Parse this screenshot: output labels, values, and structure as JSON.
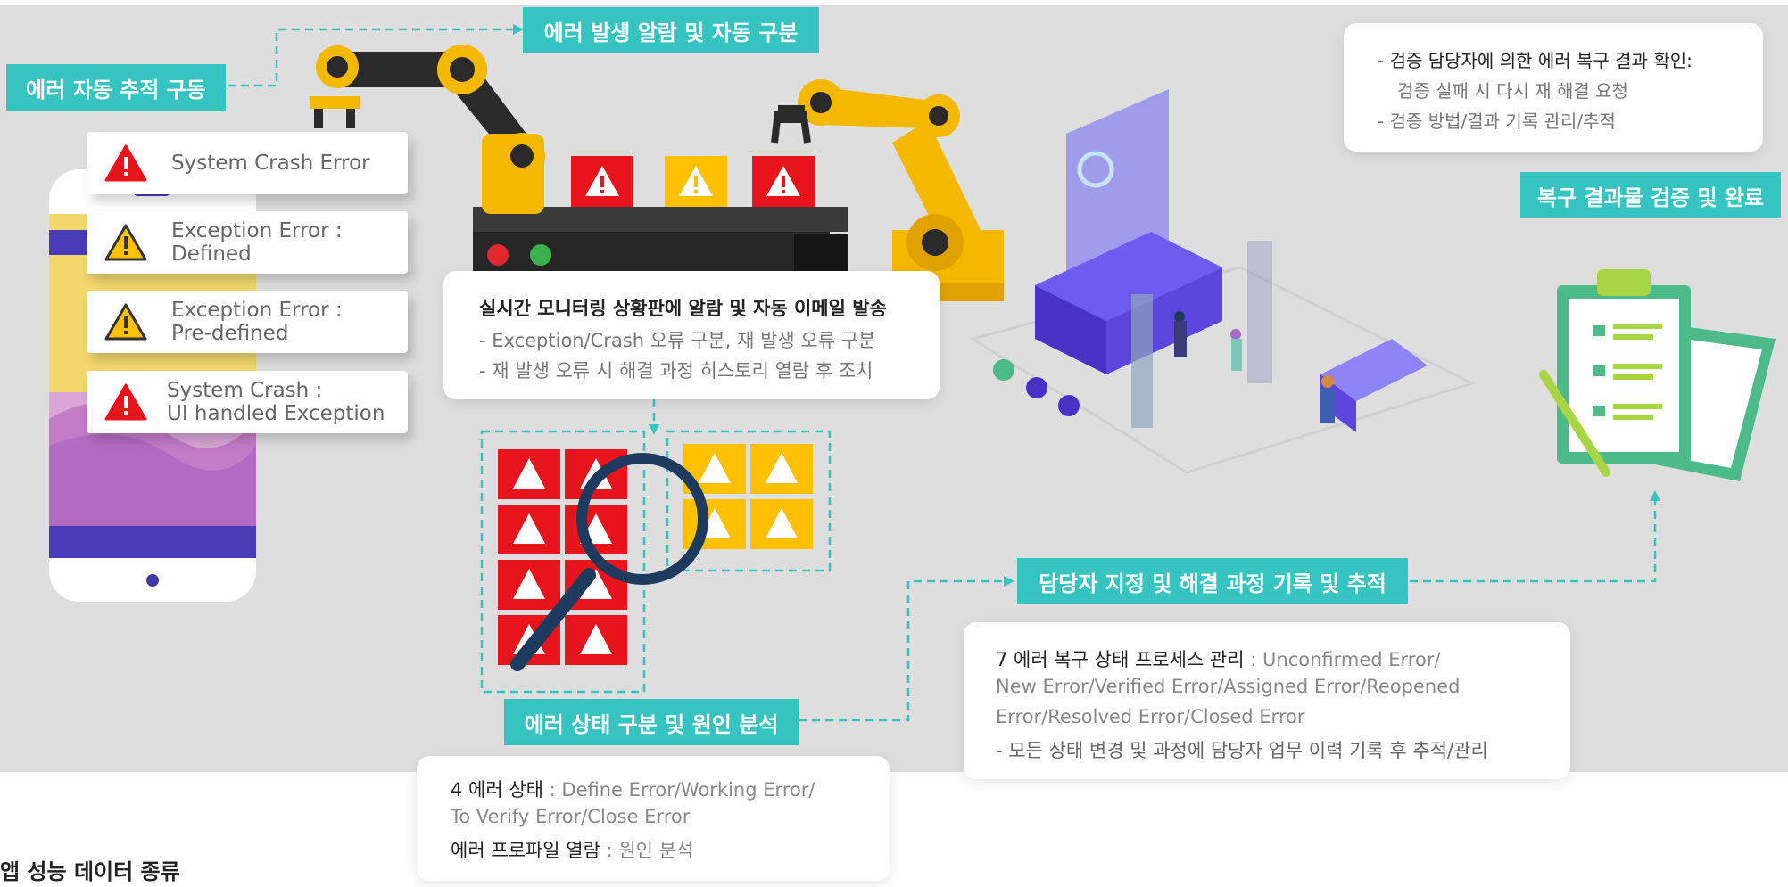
{
  "labels": {
    "auto_trace": "에러 자동 추적 구동",
    "alarm_classify": "에러 발생 알람 및 자동 구분",
    "status_analysis": "에러 상태 구분 및 원인 분석",
    "assign_track": "담당자 지정 및 해결 과정 기록 및 추적",
    "verify_complete": "복구 결과물 검증 및 완료"
  },
  "error_cards": [
    {
      "icon": "error-red-icon",
      "line1": "System Crash Error",
      "line2": ""
    },
    {
      "icon": "warning-yellow-icon",
      "line1": "Exception Error :",
      "line2": "Defined"
    },
    {
      "icon": "warning-yellow-icon",
      "line1": "Exception Error :",
      "line2": "Pre-defined"
    },
    {
      "icon": "error-red-icon",
      "line1": "System Crash :",
      "line2": "UI handled Exception"
    }
  ],
  "monitoring": {
    "title": "실시간 모니터링 상황판에 알람 및 자동 이메일 발송",
    "line1": "- Exception/Crash 오류 구분, 재 발생 오류 구분",
    "line2": "- 재 발생 오류 시 해결 과정 히스토리 열람 후 조치"
  },
  "verify_box": {
    "line1": "- 검증 담당자에 의한 에러 복구 결과 확인:",
    "line2": "검증 실패 시 다시 재 해결 요청",
    "line3": "- 검증 방법/결과 기록 관리/추적"
  },
  "process_box": {
    "bold": "7 에러 복구 상태 프로세스 관리",
    "sep": " : ",
    "line1_rest": "Unconfirmed Error/",
    "line2": "New Error/Verified Error/Assigned Error/Reopened",
    "line3": "Error/Resolved Error/Closed Error",
    "line4": "- 모든 상태 변경 및 과정에 담당자 업무 이력 기록 후 추적/관리"
  },
  "status_box": {
    "bold1": "4 에러 상태",
    "rest1": " : Define Error/Working Error/",
    "line2": "To Verify Error/Close Error",
    "bold3": "에러 프로파일 열람",
    "rest3": " : 원인 분석"
  },
  "footer_heading": "앱 성능 데이터 종류",
  "colors": {
    "teal": "#35c4c0",
    "red": "#e8141b",
    "yellow": "#ffc000",
    "robot_yellow": "#f5b800",
    "purple": "#5a3fd8",
    "green": "#4dba8a"
  }
}
